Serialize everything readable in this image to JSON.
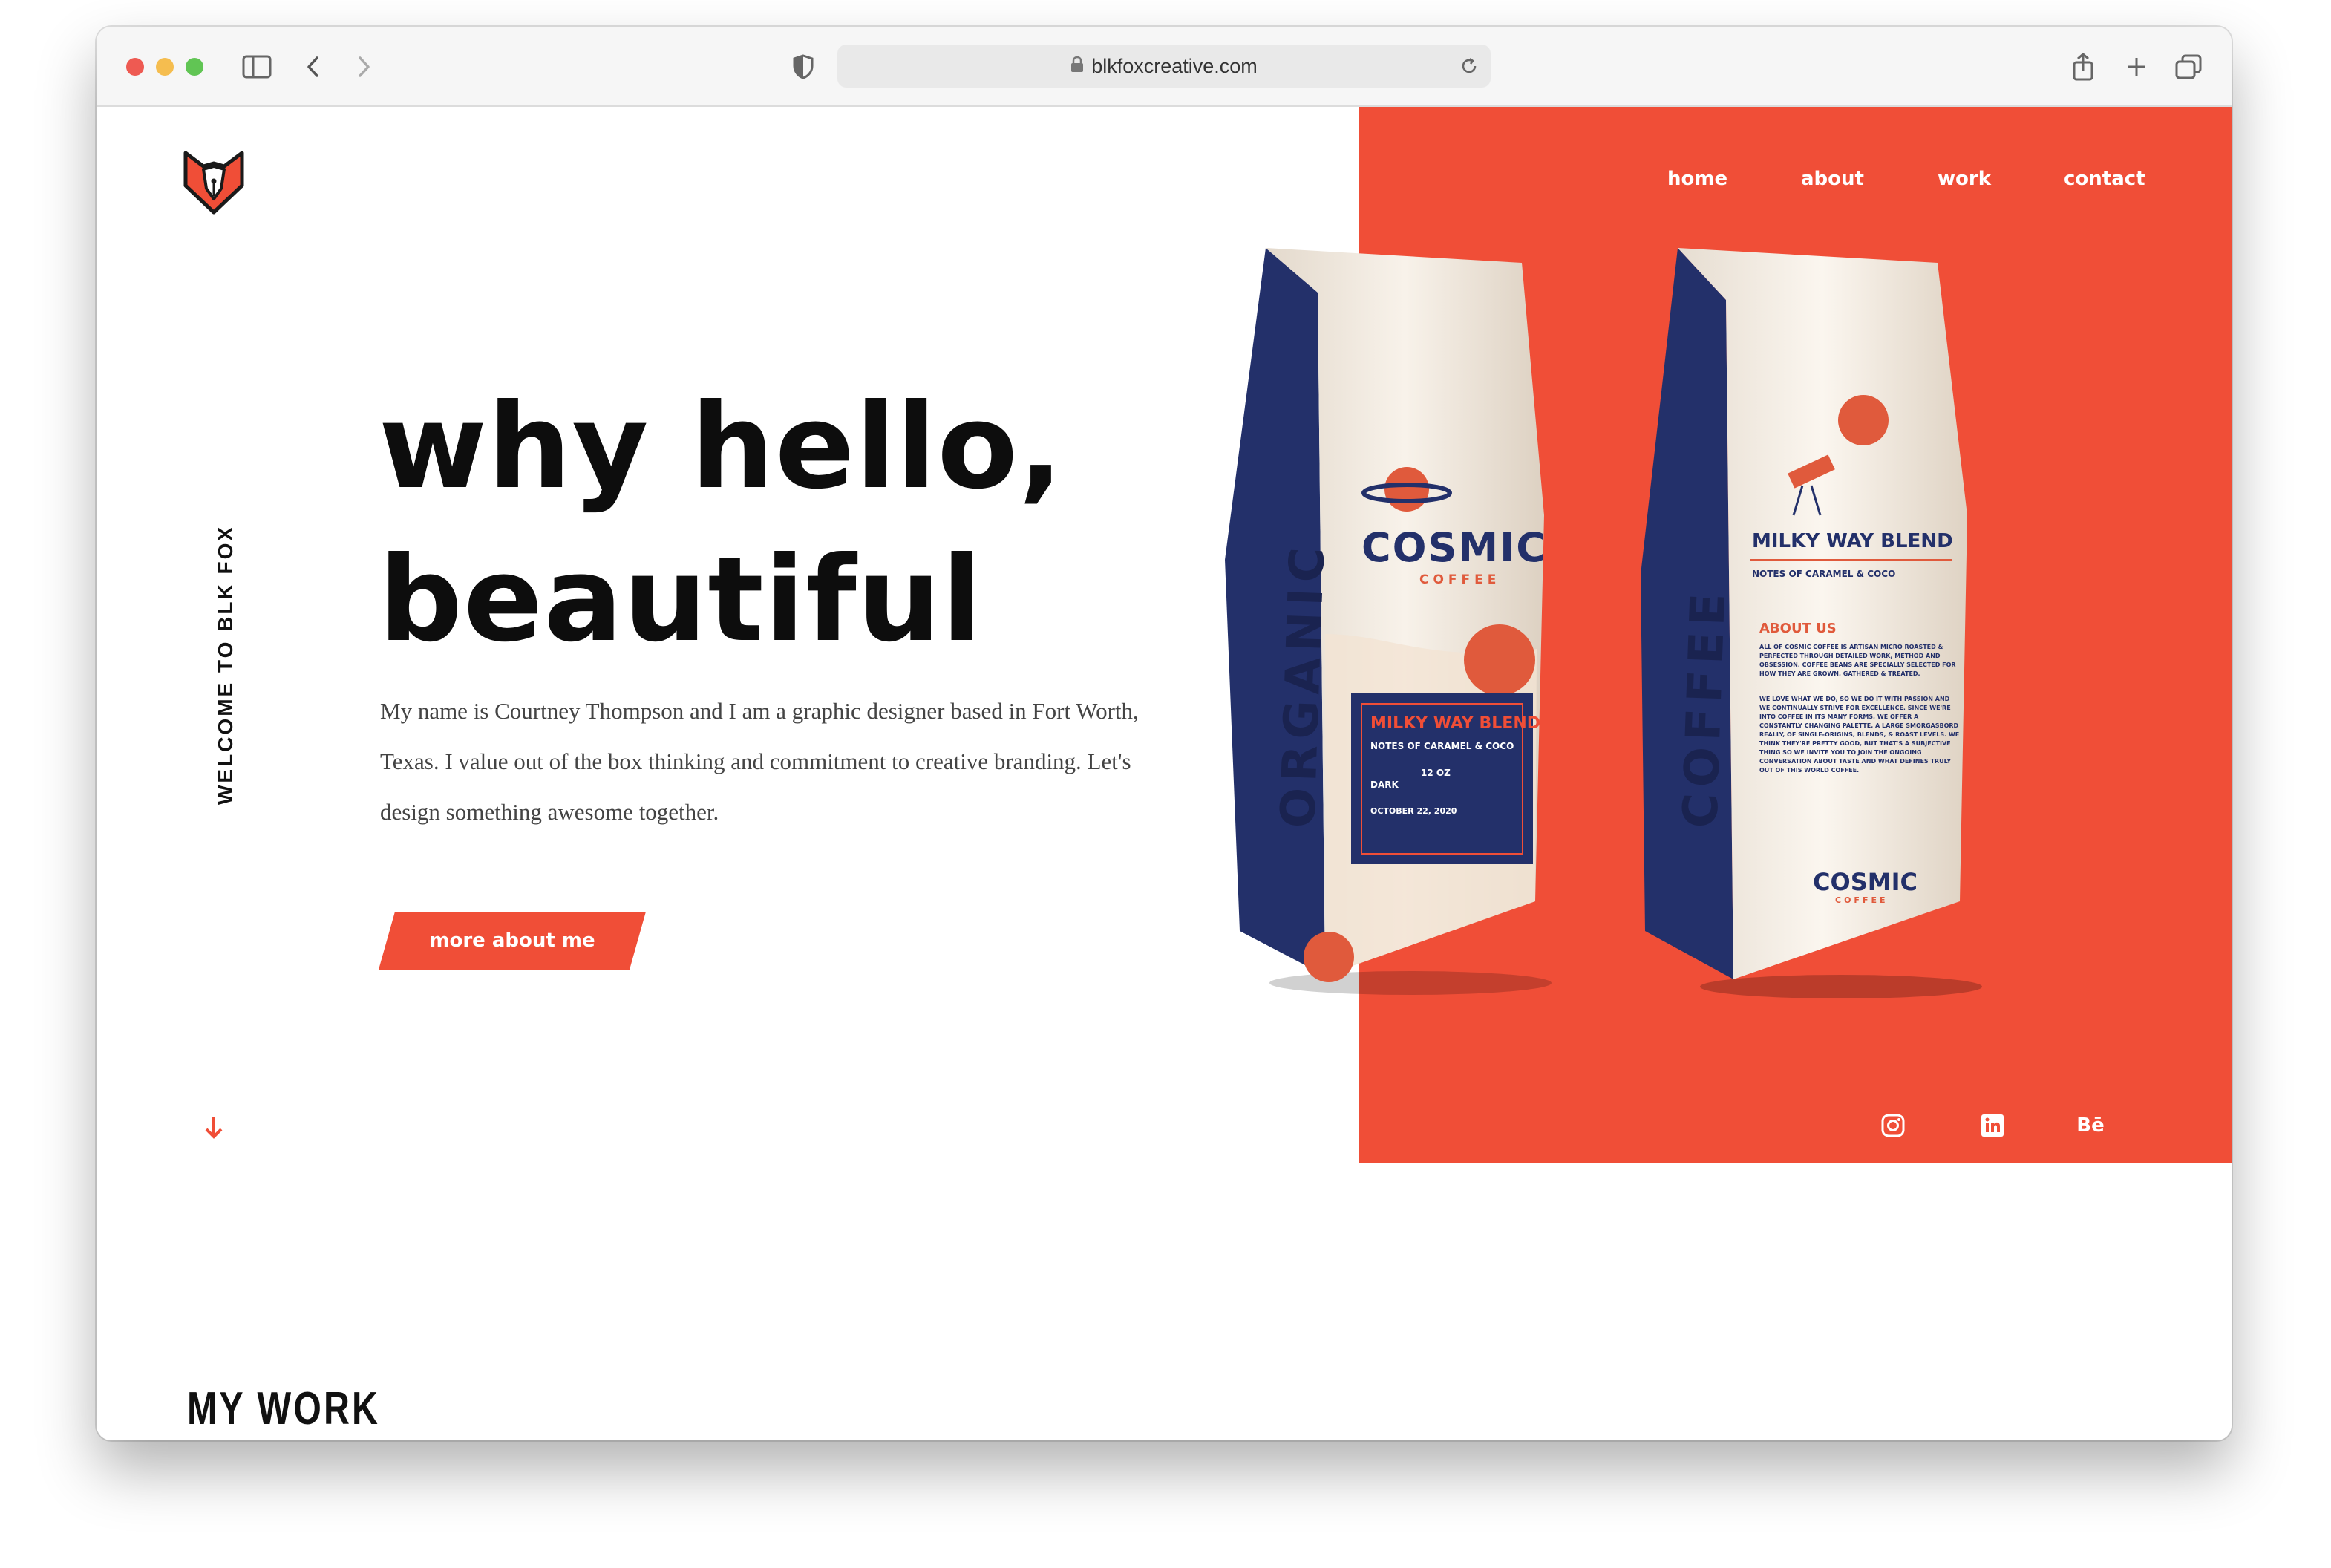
{
  "browser": {
    "url": "blkfoxcreative.com"
  },
  "nav": {
    "items": [
      {
        "label": "home"
      },
      {
        "label": "about"
      },
      {
        "label": "work"
      },
      {
        "label": "contact"
      }
    ]
  },
  "hero": {
    "side_label": "WELCOME TO BLK FOX",
    "headline_line1": "why hello,",
    "headline_line2": "beautiful",
    "intro": "My name is Courtney Thompson and I am a graphic designer based in Fort Worth, Texas. I value out of the box thinking and commitment to creative branding. Let's design something awesome together.",
    "cta_label": "more about me"
  },
  "product": {
    "front": {
      "brand": "COSMIC",
      "sub": "COFFEE",
      "side_text": "ORGANIC",
      "label_title": "MILKY WAY BLEND",
      "label_notes": "NOTES OF CARAMEL & COCO",
      "roast": "DARK",
      "weight": "12 OZ",
      "date": "OCTOBER 22, 2020"
    },
    "back": {
      "title": "MILKY WAY BLEND",
      "notes": "NOTES OF CARAMEL & COCO",
      "about_title": "ABOUT US",
      "about_text": "ALL OF COSMIC COFFEE IS ARTISAN MICRO ROASTED & PERFECTED THROUGH DETAILED WORK, METHOD AND OBSESSION. COFFEE BEANS ARE SPECIALLY SELECTED FOR HOW THEY ARE GROWN, GATHERED & TREATED.",
      "about_text2": "WE LOVE WHAT WE DO, SO WE DO IT WITH PASSION AND WE CONTINUALLY STRIVE FOR EXCELLENCE. SINCE WE'RE INTO COFFEE IN ITS MANY FORMS, WE OFFER A CONSTANTLY CHANGING PALETTE, A LARGE SMORGASBORD REALLY, OF SINGLE-ORIGINS, BLENDS, & ROAST LEVELS. WE THINK THEY'RE PRETTY GOOD, BUT THAT'S A SUBJECTIVE THING SO WE INVITE YOU TO JOIN THE ONGOING CONVERSATION ABOUT TASTE AND WHAT DEFINES TRULY OUT OF THIS WORLD COFFEE.",
      "side_text": "COFFEE",
      "brand": "COSMIC",
      "sub": "COFFEE"
    }
  },
  "social": {
    "behance": "Bē"
  },
  "sections": {
    "work_title": "MY WORK"
  },
  "colors": {
    "accent": "#f04e37",
    "navy": "#1d2a5c",
    "cream": "#f1e9df"
  }
}
